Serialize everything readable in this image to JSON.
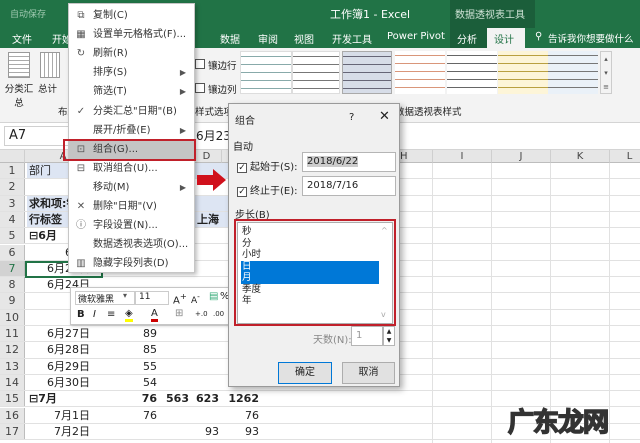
{
  "titlebar": {
    "autosave": "自动保存",
    "title": "工作簿1  -  Excel",
    "tools": "数据透视表工具"
  },
  "tabs": [
    "文件",
    "开始",
    "数据",
    "审阅",
    "视图",
    "开发工具",
    "Power Pivot",
    "分析",
    "设计"
  ],
  "tell_me": "告诉我你想要做什么",
  "ribbon": {
    "subtotal": "分类汇总",
    "grand_total": "总计",
    "layout_group": "布局",
    "banded_rows": "镶边行",
    "banded_cols": "镶边列",
    "style_options_group": "样式选项",
    "styles_group": "数据透视表样式"
  },
  "name_box": "A7",
  "formula_value": "6月23日",
  "columns": [
    "A",
    "B",
    "C",
    "D",
    "E",
    "F",
    "G",
    "H",
    "I",
    "J",
    "K",
    "L"
  ],
  "rows": [
    {
      "n": "1",
      "a": "部门",
      "b": "",
      "c": "",
      "d": "",
      "e": ""
    },
    {
      "n": "2",
      "a": "",
      "b": "",
      "c": "",
      "d": "",
      "e": ""
    },
    {
      "n": "3",
      "a": "求和项:销",
      "b": "",
      "c": "",
      "d": "",
      "e": ""
    },
    {
      "n": "4",
      "a": "行标签",
      "b": "",
      "c": "",
      "d": "上海",
      "e": "总"
    },
    {
      "n": "5",
      "a": "⊟6月",
      "b": "",
      "c": "",
      "d": "",
      "e": ""
    },
    {
      "n": "6",
      "a": "6月2",
      "b": "",
      "c": "",
      "d": "",
      "e": ""
    },
    {
      "n": "7",
      "a": "6月23日",
      "b": "73",
      "c": "",
      "d": "",
      "e": ""
    },
    {
      "n": "8",
      "a": "6月24日",
      "b": "",
      "c": "",
      "d": "",
      "e": ""
    },
    {
      "n": "9",
      "a": "6月",
      "b": "",
      "c": "",
      "d": "",
      "e": ""
    },
    {
      "n": "10",
      "a": "6月",
      "b": "",
      "c": "",
      "d": "",
      "e": ""
    },
    {
      "n": "11",
      "a": "6月27日",
      "b": "89",
      "c": "",
      "d": "",
      "e": ""
    },
    {
      "n": "12",
      "a": "6月28日",
      "b": "85",
      "c": "",
      "d": "",
      "e": ""
    },
    {
      "n": "13",
      "a": "6月29日",
      "b": "55",
      "c": "",
      "d": "",
      "e": ""
    },
    {
      "n": "14",
      "a": "6月30日",
      "b": "54",
      "c": "",
      "d": "",
      "e": ""
    },
    {
      "n": "15",
      "a": "⊟7月",
      "b": "76",
      "c": "563",
      "d": "623",
      "e": "1262"
    },
    {
      "n": "16",
      "a": "7月1日",
      "b": "76",
      "c": "",
      "d": "",
      "e": "76"
    },
    {
      "n": "17",
      "a": "7月2日",
      "b": "",
      "c": "",
      "d": "93",
      "e": "93"
    }
  ],
  "context_menu": [
    {
      "label": "复制(C)",
      "icon": "copy-icon"
    },
    {
      "label": "设置单元格格式(F)...",
      "icon": "format-cells-icon"
    },
    {
      "label": "刷新(R)",
      "icon": "refresh-icon"
    },
    {
      "label": "排序(S)",
      "sub": true
    },
    {
      "label": "筛选(T)",
      "sub": true
    },
    {
      "label": "分类汇总\"日期\"(B)",
      "icon": "check-icon"
    },
    {
      "label": "展开/折叠(E)",
      "sub": true
    },
    {
      "label": "组合(G)...",
      "icon": "group-icon",
      "highlight": true
    },
    {
      "label": "取消组合(U)...",
      "icon": "ungroup-icon"
    },
    {
      "label": "移动(M)",
      "sub": true
    },
    {
      "label": "删除\"日期\"(V)",
      "icon": "delete-x-icon"
    },
    {
      "label": "字段设置(N)...",
      "icon": "field-settings-icon"
    },
    {
      "label": "数据透视表选项(O)..."
    },
    {
      "label": "隐藏字段列表(D)",
      "icon": "field-list-icon"
    }
  ],
  "mini_toolbar": {
    "font": "微软雅黑",
    "size": "11"
  },
  "dialog": {
    "title": "组合",
    "help": "?",
    "auto": "自动",
    "start_label": "起始于(S):",
    "start_value": "2018/6/22",
    "end_label": "终止于(E):",
    "end_value": "2018/7/16",
    "step_label": "步长(B)",
    "step_items": [
      "秒",
      "分",
      "小时",
      "日",
      "月",
      "季度",
      "年"
    ],
    "selected": [
      "日",
      "月"
    ],
    "days_label": "天数(N):",
    "days_value": "1",
    "ok": "确定",
    "cancel": "取消"
  },
  "watermark": "广东龙网",
  "colors": {
    "excel_green": "#217346",
    "highlight_red": "#c0202a",
    "selection_blue": "#0078d7"
  }
}
